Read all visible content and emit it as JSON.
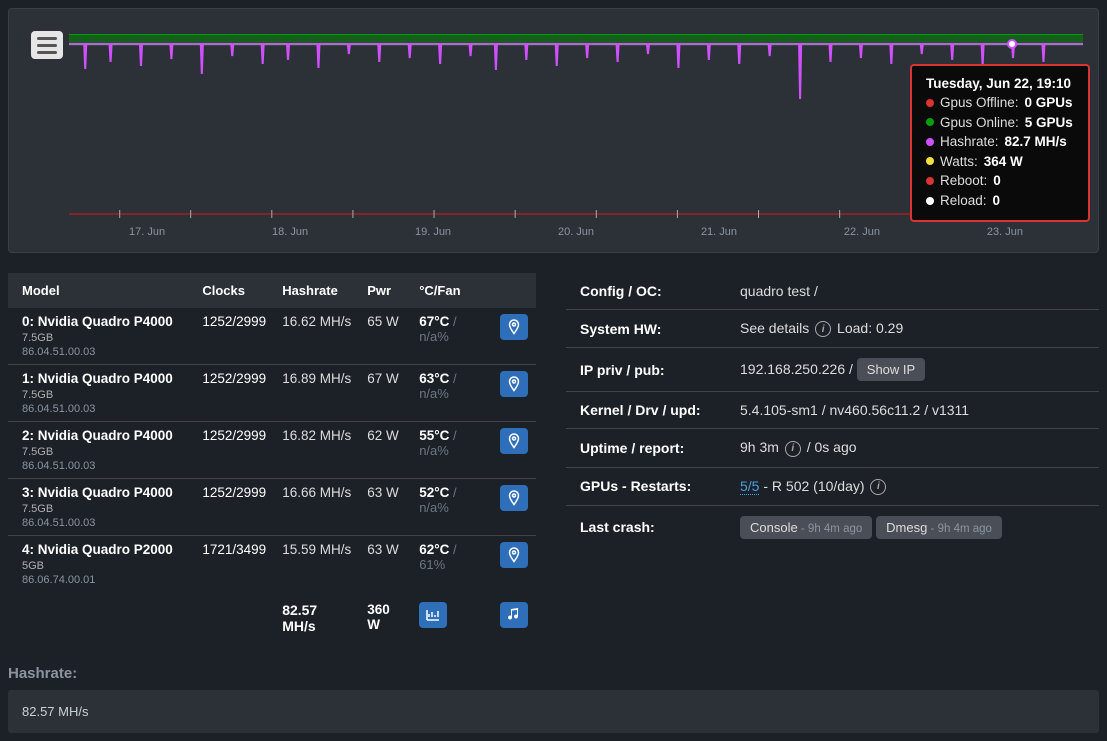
{
  "chart": {
    "x_ticks": [
      "17. Jun",
      "18. Jun",
      "19. Jun",
      "20. Jun",
      "21. Jun",
      "22. Jun",
      "23. Jun"
    ]
  },
  "tooltip": {
    "title": "Tuesday, Jun 22, 19:10",
    "rows": [
      {
        "color": "red",
        "label": "Gpus Offline:",
        "value": "0 GPUs"
      },
      {
        "color": "green",
        "label": "Gpus Online:",
        "value": "5 GPUs"
      },
      {
        "color": "magenta",
        "label": "Hashrate:",
        "value": "82.7 MH/s"
      },
      {
        "color": "yellow",
        "label": "Watts:",
        "value": "364 W"
      },
      {
        "color": "red",
        "label": "Reboot:",
        "value": "0"
      },
      {
        "color": "white",
        "label": "Reload:",
        "value": "0"
      }
    ]
  },
  "gpu_table": {
    "headers": {
      "model": "Model",
      "clocks": "Clocks",
      "hashrate": "Hashrate",
      "pwr": "Pwr",
      "temp_fan": "°C/Fan"
    },
    "rows": [
      {
        "idx": "0:",
        "model": "Nvidia Quadro P4000",
        "mem": "7.5GB",
        "sub": "86.04.51.00.03",
        "clocks": "1252/2999",
        "hashrate": "16.62 MH/s",
        "pwr": "65 W",
        "temp": "67°C",
        "fan": " / n/a%"
      },
      {
        "idx": "1:",
        "model": "Nvidia Quadro P4000",
        "mem": "7.5GB",
        "sub": "86.04.51.00.03",
        "clocks": "1252/2999",
        "hashrate": "16.89 MH/s",
        "pwr": "67 W",
        "temp": "63°C",
        "fan": " / n/a%"
      },
      {
        "idx": "2:",
        "model": "Nvidia Quadro P4000",
        "mem": "7.5GB",
        "sub": "86.04.51.00.03",
        "clocks": "1252/2999",
        "hashrate": "16.82 MH/s",
        "pwr": "62 W",
        "temp": "55°C",
        "fan": " / n/a%"
      },
      {
        "idx": "3:",
        "model": "Nvidia Quadro P4000",
        "mem": "7.5GB",
        "sub": "86.04.51.00.03",
        "clocks": "1252/2999",
        "hashrate": "16.66 MH/s",
        "pwr": "63 W",
        "temp": "52°C",
        "fan": " / n/a%"
      },
      {
        "idx": "4:",
        "model": "Nvidia Quadro P2000",
        "mem": "5GB",
        "sub": "86.06.74.00.01",
        "clocks": "1721/3499",
        "hashrate": "15.59 MH/s",
        "pwr": "63 W",
        "temp": "62°C",
        "fan": " / 61%"
      }
    ],
    "totals": {
      "hashrate": "82.57 MH/s",
      "pwr": "360 W"
    }
  },
  "info": {
    "config_label": "Config / OC:",
    "config_value": "quadro test /",
    "hw_label": "System HW:",
    "hw_value_prefix": "See details ",
    "hw_load": " Load: 0.29",
    "ip_label": "IP priv / pub:",
    "ip_value": "192.168.250.226 / ",
    "show_ip": "Show IP",
    "kernel_label": "Kernel / Drv / upd:",
    "kernel_value": "5.4.105-sm1 / nv460.56c11.2 / v1311",
    "uptime_label": "Uptime / report:",
    "uptime_value_prefix": "9h 3m ",
    "uptime_value_suffix": " / 0s ago",
    "gpus_label": "GPUs - Restarts:",
    "gpus_link": "5/5",
    "gpus_rest": " - R 502 (10/day) ",
    "crash_label": "Last crash:",
    "console_btn": "Console",
    "console_ago": " - 9h 4m ago",
    "dmesg_btn": "Dmesg",
    "dmesg_ago": " - 9h 4m ago"
  },
  "hashrate_section": {
    "title": "Hashrate:",
    "value": "82.57 MH/s"
  }
}
